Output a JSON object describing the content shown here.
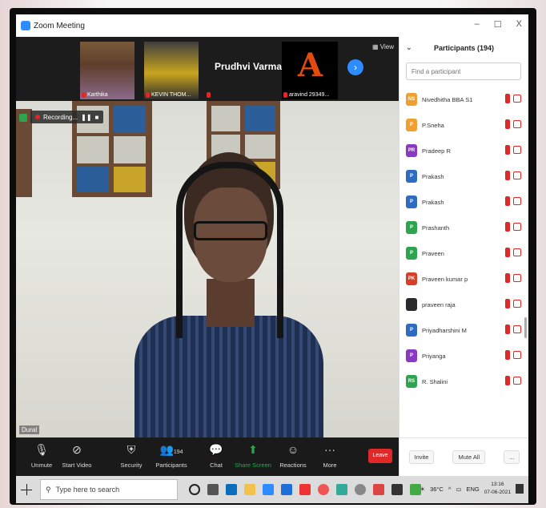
{
  "window": {
    "title": "Zoom Meeting",
    "minimize": "–",
    "maximize": "☐",
    "close": "X"
  },
  "thumbnails": [
    {
      "name": "Karthika"
    },
    {
      "name": "KEVIN THOM..."
    },
    {
      "name": "Prudhvi Varma"
    },
    {
      "name": "aravind 29349..."
    }
  ],
  "view_label": "View",
  "recording_label": "Recording...",
  "speaker_label": "Dural",
  "toolbar": {
    "unmute": "Unmute",
    "start_video": "Start Video",
    "security": "Security",
    "participants": "Participants",
    "participants_count": "194",
    "chat": "Chat",
    "share_screen": "Share Screen",
    "reactions": "Reactions",
    "more": "More",
    "leave": "Leave"
  },
  "panel": {
    "title": "Participants (194)",
    "search_placeholder": "Find a participant",
    "invite": "Invite",
    "mute_all": "Mute All",
    "more": "..."
  },
  "participants": [
    {
      "initials": "NS",
      "name": "Nivedhitha BBA S1",
      "color": "#f0a030"
    },
    {
      "initials": "P",
      "name": "P.Sneha",
      "color": "#f0a030"
    },
    {
      "initials": "PR",
      "name": "Pradeep R",
      "color": "#8a3ac2"
    },
    {
      "initials": "P",
      "name": "Prakash",
      "color": "#2d6cc0"
    },
    {
      "initials": "P",
      "name": "Prakash",
      "color": "#2d6cc0"
    },
    {
      "initials": "P",
      "name": "Prashanth",
      "color": "#2ea44f"
    },
    {
      "initials": "P",
      "name": "Praveen",
      "color": "#2ea44f"
    },
    {
      "initials": "PK",
      "name": "Praveen kumar p",
      "color": "#d6402a"
    },
    {
      "initials": "",
      "name": "praveen raja",
      "color": "#2a2a2a"
    },
    {
      "initials": "P",
      "name": "Priyadharshini M",
      "color": "#2d6cc0"
    },
    {
      "initials": "P",
      "name": "Priyanga",
      "color": "#8a3ac2"
    },
    {
      "initials": "RS",
      "name": "R. Shalini",
      "color": "#2ea44f"
    }
  ],
  "taskbar": {
    "search_placeholder": "Type here to search",
    "temperature": "36°C",
    "language": "ENG",
    "time": "13:16",
    "date": "07-06-2021"
  }
}
